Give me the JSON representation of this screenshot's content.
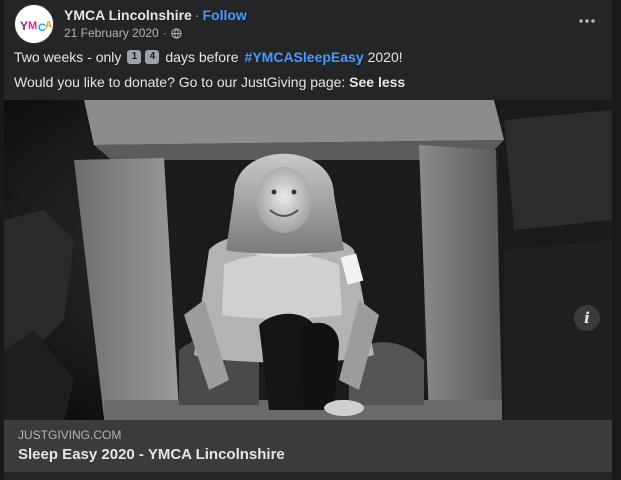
{
  "post": {
    "page_name": "YMCA Lincolnshire",
    "separator": "·",
    "follow_label": "Follow",
    "date": "21 February 2020",
    "date_separator": "·",
    "privacy_icon": "globe-icon",
    "more_icon": "ellipsis-icon",
    "avatar_text": "YMCA",
    "text_part1": "Two weeks - only",
    "keycap_1": "1",
    "keycap_2": "4",
    "text_part2": "days before",
    "hashtag": "#YMCASleepEasy",
    "text_part3": "2020!",
    "text_line2": "Would you like to donate? Go to our JustGiving page:",
    "see_less_label": "See less"
  },
  "link_preview": {
    "domain": "JUSTGIVING.COM",
    "title": "Sleep Easy 2020 - YMCA Lincolnshire",
    "info_icon": "info-icon",
    "info_label": "i"
  },
  "colors": {
    "background": "#18191a",
    "card": "#242526",
    "link_blue": "#4599ff",
    "secondary_text": "#b0b3b8",
    "preview_bg": "#3a3b3c"
  }
}
